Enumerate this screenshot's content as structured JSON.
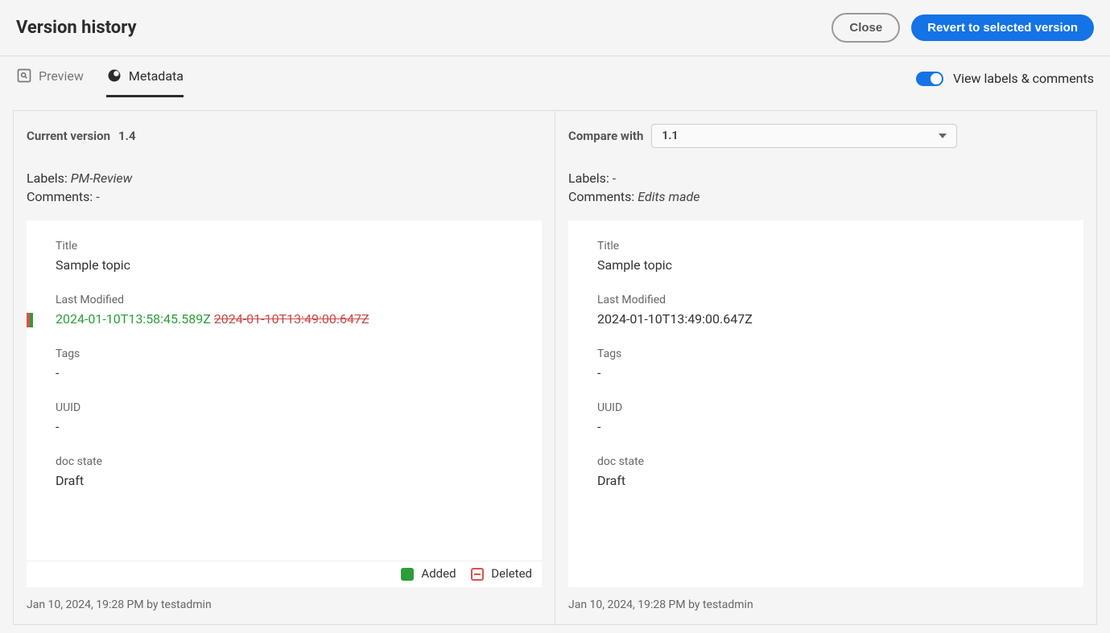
{
  "header": {
    "title": "Version history",
    "close_label": "Close",
    "revert_label": "Revert to selected version"
  },
  "tabs": {
    "preview": "Preview",
    "metadata": "Metadata"
  },
  "toggle": {
    "label": "View labels & comments"
  },
  "left": {
    "header_label": "Current version",
    "header_version": "1.4",
    "labels_key": "Labels:",
    "labels_value": "PM-Review",
    "comments_key": "Comments:",
    "comments_value": "-",
    "fields": {
      "title_label": "Title",
      "title_value": "Sample topic",
      "modified_label": "Last Modified",
      "modified_added": "2024-01-10T13:58:45.589Z",
      "modified_deleted": "2024-01-10T13:49:00.647Z",
      "tags_label": "Tags",
      "tags_value": "-",
      "uuid_label": "UUID",
      "uuid_value": "-",
      "docstate_label": "doc state",
      "docstate_value": "Draft"
    },
    "legend": {
      "added": "Added",
      "deleted": "Deleted"
    },
    "footer": "Jan 10, 2024, 19:28 PM by testadmin"
  },
  "right": {
    "header_label": "Compare with",
    "select_value": "1.1",
    "labels_key": "Labels:",
    "labels_value": "-",
    "comments_key": "Comments:",
    "comments_value": "Edits made",
    "fields": {
      "title_label": "Title",
      "title_value": "Sample topic",
      "modified_label": "Last Modified",
      "modified_value": "2024-01-10T13:49:00.647Z",
      "tags_label": "Tags",
      "tags_value": "-",
      "uuid_label": "UUID",
      "uuid_value": "-",
      "docstate_label": "doc state",
      "docstate_value": "Draft"
    },
    "footer": "Jan 10, 2024, 19:28 PM by testadmin"
  }
}
